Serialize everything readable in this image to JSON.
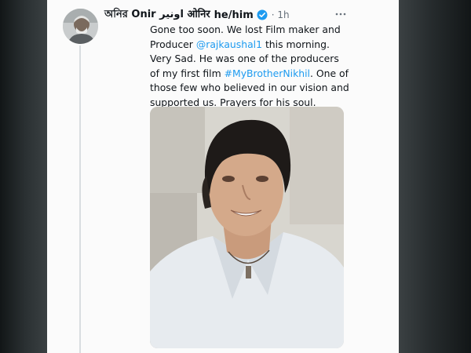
{
  "tweet": {
    "display_name": "অনির Onir اونیر ओनिर",
    "pronouns": "he/him",
    "time": "1h",
    "more_icon": "more-horizontal-icon",
    "verified_icon": "verified-badge-icon",
    "lines": [
      {
        "text": "Gone too soon. We lost Film maker and"
      },
      {
        "pre": "Producer ",
        "link": "@rajkaushal1",
        "post": " this morning."
      },
      {
        "text": "Very Sad. He was one of the producers"
      },
      {
        "pre": "of my first film ",
        "link": "#MyBrotherNikhil",
        "post": ". One of"
      },
      {
        "text": "those few who believed in our vision and"
      },
      {
        "text": "supported us. Prayers for his soul."
      }
    ],
    "colors": {
      "text": "#0f1419",
      "link": "#1d9bf0",
      "muted": "#66707a",
      "verified": "#1d9bf0"
    }
  }
}
